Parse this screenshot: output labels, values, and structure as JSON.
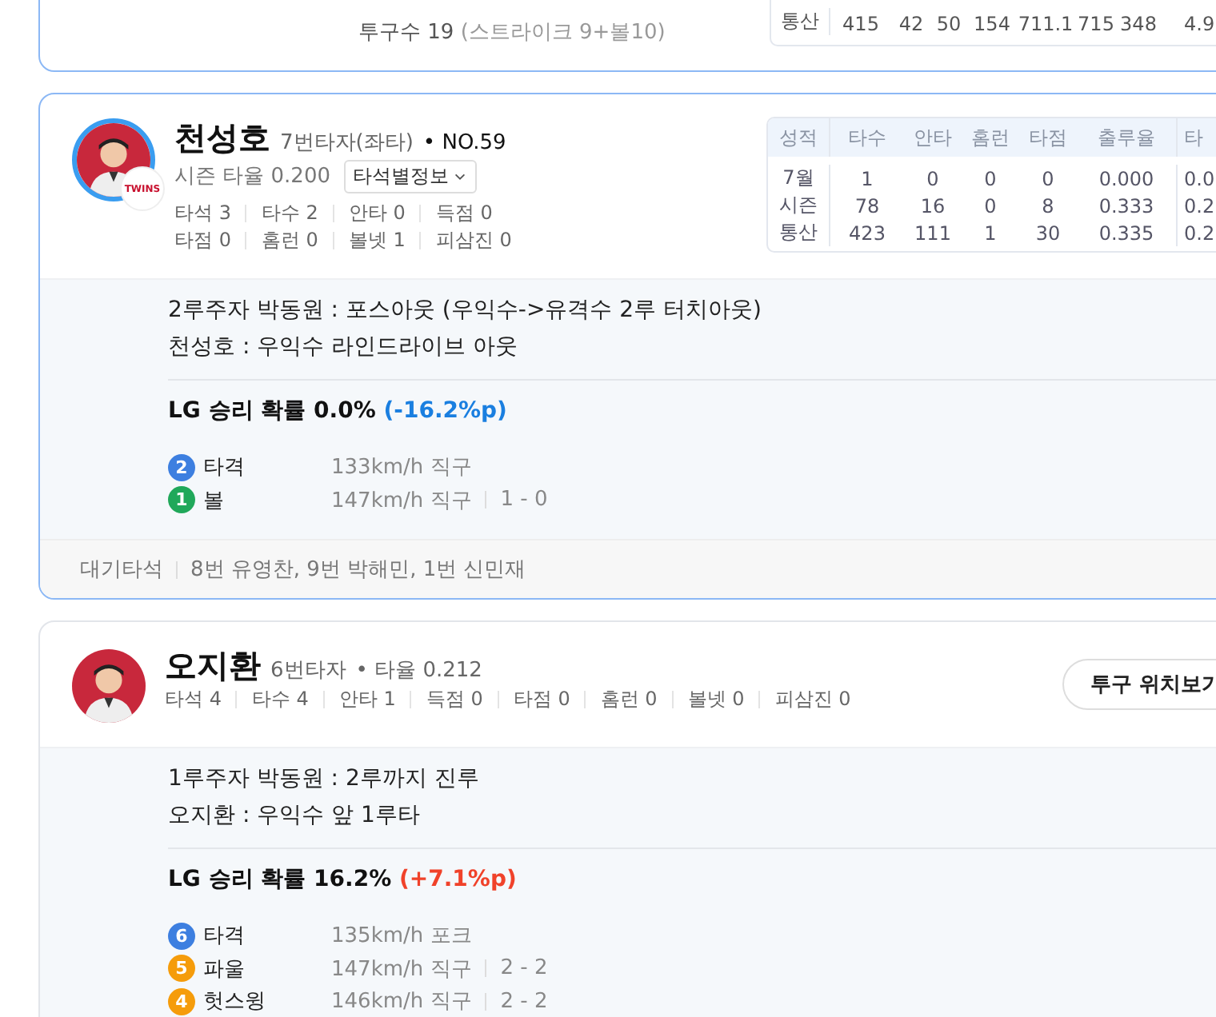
{
  "cards": [
    {
      "kind": "partial",
      "pitch_count": {
        "label": "투구수",
        "value": "19",
        "detail": "(스트라이크 9+볼10)"
      },
      "career_row": {
        "label": "통산",
        "values": [
          "415",
          "42",
          "50",
          "154",
          "711.1",
          "715",
          "348",
          "4.9"
        ]
      },
      "highlighted": true
    },
    {
      "kind": "batter",
      "highlighted": true,
      "ring": true,
      "name": "천성호",
      "role": "7번타자(좌타)",
      "number": "• NO.59",
      "season_avg": {
        "label": "시즌 타율",
        "value": "0.200"
      },
      "dropdown": "타석별정보",
      "team_logo": "TWINS",
      "stats": [
        [
          {
            "label": "타석",
            "value": "3"
          },
          {
            "label": "타수",
            "value": "2"
          },
          {
            "label": "안타",
            "value": "0"
          },
          {
            "label": "득점",
            "value": "0"
          }
        ],
        [
          {
            "label": "타점",
            "value": "0"
          },
          {
            "label": "홈런",
            "value": "0"
          },
          {
            "label": "볼넷",
            "value": "1"
          },
          {
            "label": "피삼진",
            "value": "0"
          }
        ]
      ],
      "record_table": {
        "columns": [
          "성적",
          "타수",
          "안타",
          "홈런",
          "타점",
          "출루율",
          "타"
        ],
        "rows": [
          [
            "7월",
            "1",
            "0",
            "0",
            "0",
            "0.000",
            "0.0"
          ],
          [
            "시즌",
            "78",
            "16",
            "0",
            "8",
            "0.333",
            "0.2"
          ],
          [
            "통산",
            "423",
            "111",
            "1",
            "30",
            "0.335",
            "0.2"
          ]
        ]
      },
      "plays": [
        "2루주자 박동원 : 포스아웃 (우익수->유격수 2루 터치아웃)",
        "천성호 : 우익수 라인드라이브 아웃"
      ],
      "win_prob": {
        "text": "LG 승리 확률 0.0%",
        "delta": "(-16.2%p)",
        "color": "#1a7fe0"
      },
      "pitches": [
        {
          "no": "2",
          "result": "타격",
          "color": "#3d7fe0",
          "detail": "133km/h 직구"
        },
        {
          "no": "1",
          "result": "볼",
          "color": "#20a85a",
          "detail": "147km/h 직구",
          "count": "1 - 0"
        }
      ],
      "on_deck": {
        "label": "대기타석",
        "value": "8번 유영찬, 9번 박해민, 1번 신민재"
      }
    },
    {
      "kind": "batter",
      "highlighted": false,
      "ring": false,
      "name": "오지환",
      "role": "6번타자",
      "avg_inline": "• 타율 0.212",
      "button": "투구 위치보기",
      "stats": [
        [
          {
            "label": "타석",
            "value": "4"
          },
          {
            "label": "타수",
            "value": "4"
          },
          {
            "label": "안타",
            "value": "1"
          },
          {
            "label": "득점",
            "value": "0"
          },
          {
            "label": "타점",
            "value": "0"
          },
          {
            "label": "홈런",
            "value": "0"
          },
          {
            "label": "볼넷",
            "value": "0"
          },
          {
            "label": "피삼진",
            "value": "0"
          }
        ]
      ],
      "plays": [
        "1루주자 박동원 : 2루까지 진루",
        "오지환 : 우익수 앞 1루타"
      ],
      "win_prob": {
        "text": "LG 승리 확률 16.2%",
        "delta": "(+7.1%p)",
        "color": "#f0422a"
      },
      "pitches": [
        {
          "no": "6",
          "result": "타격",
          "color": "#3d7fe0",
          "detail": "135km/h 포크"
        },
        {
          "no": "5",
          "result": "파울",
          "color": "#f59c0b",
          "detail": "147km/h 직구",
          "count": "2 - 2"
        },
        {
          "no": "4",
          "result": "헛스윙",
          "color": "#f59c0b",
          "detail": "146km/h 직구",
          "count": "2 - 2"
        }
      ]
    }
  ]
}
